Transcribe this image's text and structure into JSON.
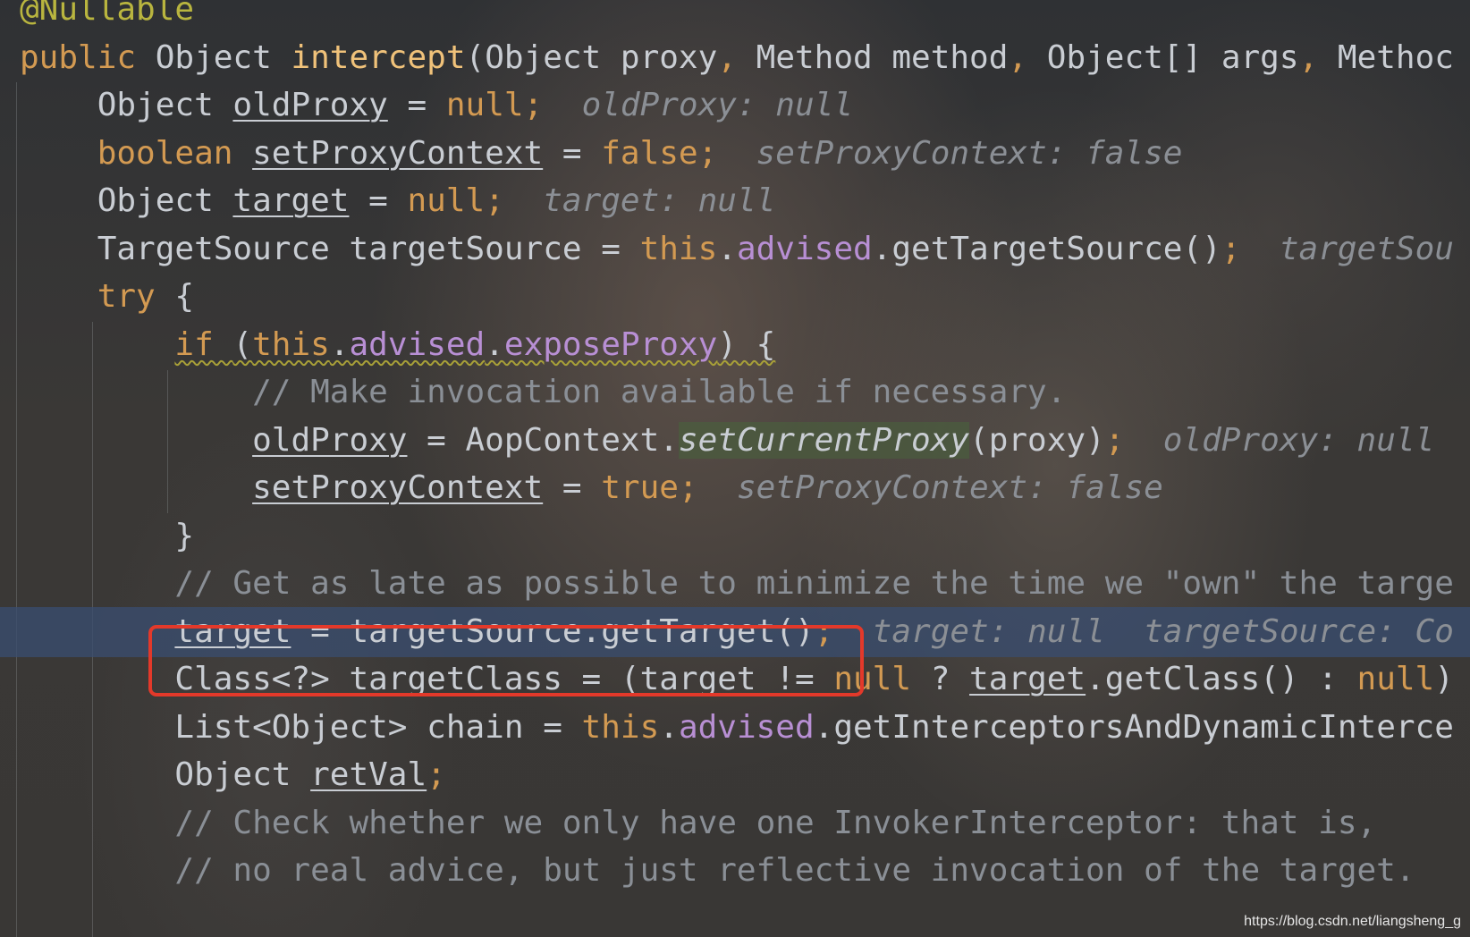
{
  "editor": {
    "lines": [
      [
        {
          "t": "@Nullable",
          "c": "ann"
        }
      ],
      [
        {
          "t": "public ",
          "c": "kw"
        },
        {
          "t": "Object "
        },
        {
          "t": "intercept",
          "c": "mth"
        },
        {
          "t": "(Object proxy"
        },
        {
          "t": ", ",
          "c": "kw"
        },
        {
          "t": "Method method"
        },
        {
          "t": ", ",
          "c": "kw"
        },
        {
          "t": "Object[] args"
        },
        {
          "t": ", ",
          "c": "kw"
        },
        {
          "t": "Methoc"
        }
      ],
      [
        {
          "t": "    Object "
        },
        {
          "t": "oldProxy",
          "c": "var"
        },
        {
          "t": " = "
        },
        {
          "t": "null;",
          "c": "kw"
        },
        {
          "t": "  oldProxy: null",
          "c": "hint"
        }
      ],
      [
        {
          "t": "    "
        },
        {
          "t": "boolean ",
          "c": "kw"
        },
        {
          "t": "setProxyContext",
          "c": "var"
        },
        {
          "t": " = "
        },
        {
          "t": "false;",
          "c": "kw"
        },
        {
          "t": "  setProxyContext: false",
          "c": "hint"
        }
      ],
      [
        {
          "t": "    Object "
        },
        {
          "t": "target",
          "c": "var"
        },
        {
          "t": " = "
        },
        {
          "t": "null;",
          "c": "kw"
        },
        {
          "t": "  target: null",
          "c": "hint"
        }
      ],
      [
        {
          "t": "    TargetSource targetSource = "
        },
        {
          "t": "this",
          "c": "kw"
        },
        {
          "t": "."
        },
        {
          "t": "advised",
          "c": "fld"
        },
        {
          "t": ".getTargetSource()"
        },
        {
          "t": ";",
          "c": "kw"
        },
        {
          "t": "  targetSou",
          "c": "hint"
        }
      ],
      [
        {
          "t": "    "
        },
        {
          "t": "try ",
          "c": "kw"
        },
        {
          "t": "{"
        }
      ],
      [
        {
          "t": "        "
        },
        {
          "t": "if ",
          "c": "kw squig"
        },
        {
          "t": "(",
          "c": "squig"
        },
        {
          "t": "this",
          "c": "kw squig"
        },
        {
          "t": ".",
          "c": "squig"
        },
        {
          "t": "advised",
          "c": "fld squig"
        },
        {
          "t": ".",
          "c": "squig"
        },
        {
          "t": "exposeProxy",
          "c": "fld squig"
        },
        {
          "t": ") {",
          "c": "squig"
        }
      ],
      [
        {
          "t": "            "
        },
        {
          "t": "// Make invocation available if necessary.",
          "c": "cmt"
        }
      ],
      [
        {
          "t": "            "
        },
        {
          "t": "oldProxy",
          "c": "var"
        },
        {
          "t": " = AopContext."
        },
        {
          "t": "setCurrentProxy",
          "c": "ital hl-green"
        },
        {
          "t": "(proxy)"
        },
        {
          "t": ";",
          "c": "kw"
        },
        {
          "t": "  oldProxy: null",
          "c": "hint"
        }
      ],
      [
        {
          "t": "            "
        },
        {
          "t": "setProxyContext",
          "c": "var"
        },
        {
          "t": " = "
        },
        {
          "t": "true;",
          "c": "kw"
        },
        {
          "t": "  setProxyContext: false",
          "c": "hint"
        }
      ],
      [
        {
          "t": "        }"
        }
      ],
      [
        {
          "t": "        "
        },
        {
          "t": "// Get as late as possible to minimize the time we \"own\" the targe",
          "c": "cmt"
        }
      ],
      [
        {
          "t": "        "
        },
        {
          "t": "target",
          "c": "var"
        },
        {
          "t": " = targetSource.getTarget()"
        },
        {
          "t": ";",
          "c": "kw"
        },
        {
          "t": "  target: null  targetSource: Co",
          "c": "hint"
        }
      ],
      [
        {
          "t": "        Class<?> targetClass = ("
        },
        {
          "t": "target",
          "c": "var"
        },
        {
          "t": " != "
        },
        {
          "t": "null ",
          "c": "kw"
        },
        {
          "t": "? "
        },
        {
          "t": "target",
          "c": "var"
        },
        {
          "t": ".getClass() : "
        },
        {
          "t": "null",
          "c": "kw"
        },
        {
          "t": ")"
        }
      ],
      [
        {
          "t": "        List<Object> chain = "
        },
        {
          "t": "this",
          "c": "kw"
        },
        {
          "t": "."
        },
        {
          "t": "advised",
          "c": "fld"
        },
        {
          "t": ".getInterceptorsAndDynamicInterce"
        }
      ],
      [
        {
          "t": "        Object "
        },
        {
          "t": "retVal",
          "c": "var"
        },
        {
          "t": ";",
          "c": "kw"
        }
      ],
      [
        {
          "t": "        "
        },
        {
          "t": "// Check whether we only have one InvokerInterceptor: that is,",
          "c": "cmt"
        }
      ],
      [
        {
          "t": "        "
        },
        {
          "t": "// no real advice, but just reflective invocation of the target.",
          "c": "cmt"
        }
      ]
    ]
  },
  "watermark": "https://blog.csdn.net/liangsheng_g"
}
